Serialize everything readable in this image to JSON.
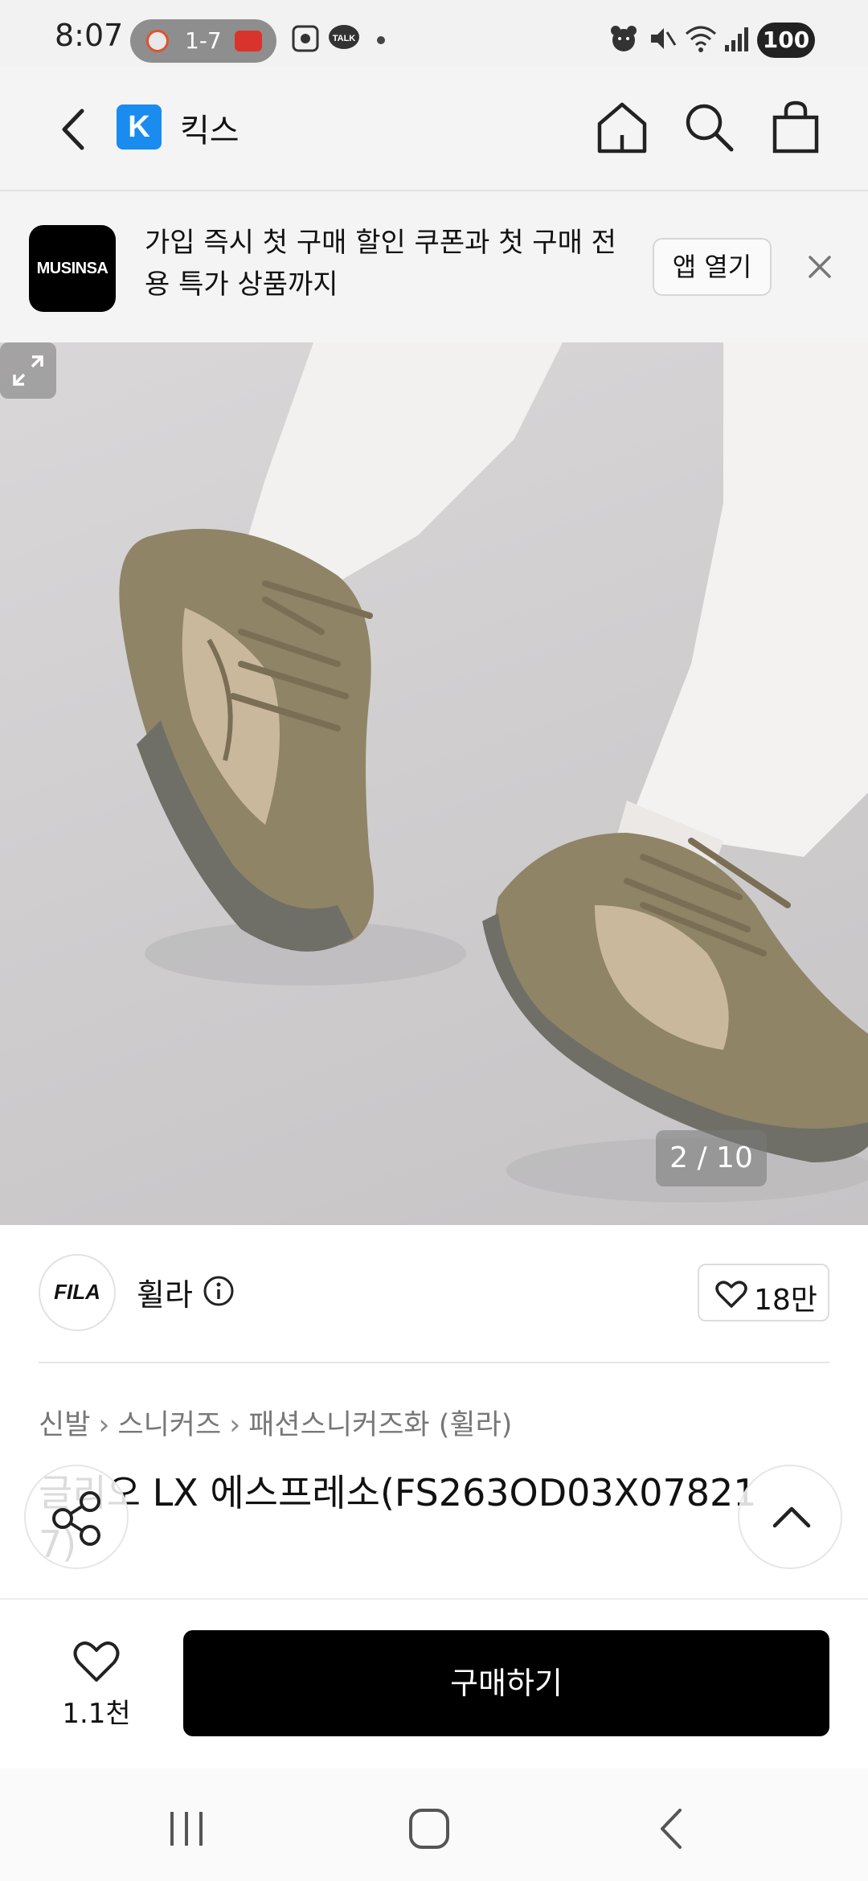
{
  "status_bar": {
    "time": "8:07",
    "pill_text": "1-7",
    "battery": "100"
  },
  "header": {
    "logo_letter": "K",
    "title": "킥스",
    "icons": [
      "back-icon",
      "home-icon",
      "search-icon",
      "shopping-bag-icon"
    ]
  },
  "banner": {
    "logo_text": "MUSINSA",
    "text": "가입 즉시 첫 구매 할인 쿠폰과 첫 구매 전용 특가 상품까지",
    "open_app_label": "앱 열기"
  },
  "gallery": {
    "counter": "2 / 10"
  },
  "brand": {
    "logo_text": "FILA",
    "name": "휠라",
    "likes": "18만"
  },
  "breadcrumb": [
    "신발",
    "스니커즈",
    "패션스니커즈화 (휠라)"
  ],
  "product": {
    "title_line1": "글리오 LX 에스프레소(FS263OD03X07821",
    "title_line2": "7)"
  },
  "purchase_bar": {
    "wish_count": "1.1천",
    "buy_label": "구매하기"
  },
  "colors": {
    "accent_blue": "#1a8cf0",
    "buy_button": "#000000"
  }
}
